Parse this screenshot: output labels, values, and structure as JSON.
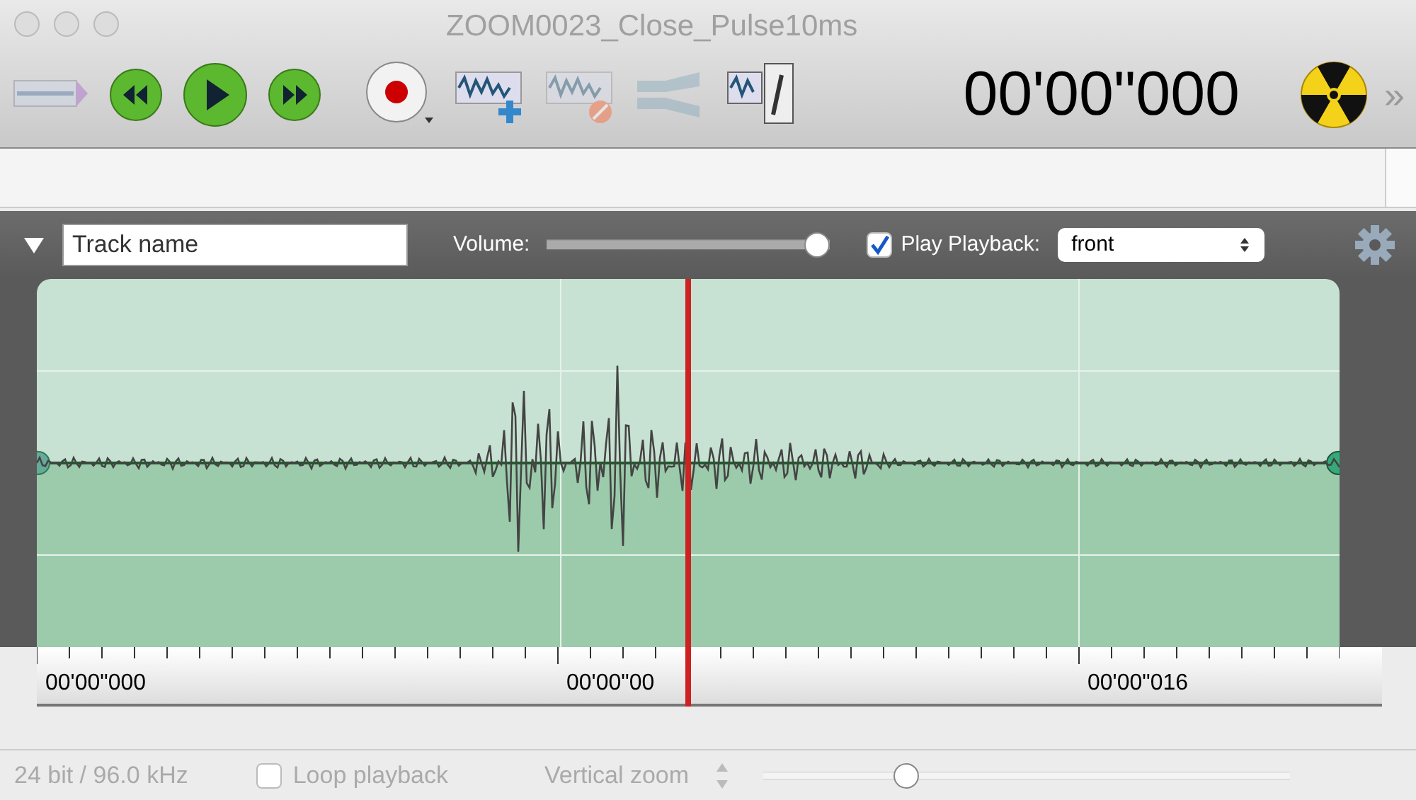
{
  "window": {
    "title": "ZOOM0023_Close_Pulse10ms"
  },
  "toolbar": {
    "buttons": [
      {
        "kind": "tracks",
        "disabled": true
      },
      {
        "kind": "rewind",
        "disabled": false
      },
      {
        "kind": "play",
        "disabled": false
      },
      {
        "kind": "forward",
        "disabled": false
      },
      {
        "kind": "record",
        "disabled": false
      },
      {
        "kind": "add",
        "disabled": false
      },
      {
        "kind": "delete",
        "disabled": true
      },
      {
        "kind": "mix",
        "disabled": true
      },
      {
        "kind": "split",
        "disabled": false
      }
    ],
    "time": "00'00\"000",
    "overflow": "»"
  },
  "track": {
    "name_placeholder": "Track name",
    "volume_label": "Volume:",
    "volume": {
      "level": 1.0
    },
    "play_checked": true,
    "play_label": "Play Playback:",
    "playback": "front",
    "playhead": {
      "level": 0.5
    }
  },
  "ruler": {
    "labels": [
      "00'00\"000",
      "00'00\"00",
      "00'00\"016"
    ]
  },
  "status_bar": {
    "format": "24 bit / 96.0 kHz",
    "loop_checked": false,
    "loop_label": "Loop playback",
    "zoom_label": "Vertical zoom",
    "zoom": {
      "level": 0.26
    }
  }
}
